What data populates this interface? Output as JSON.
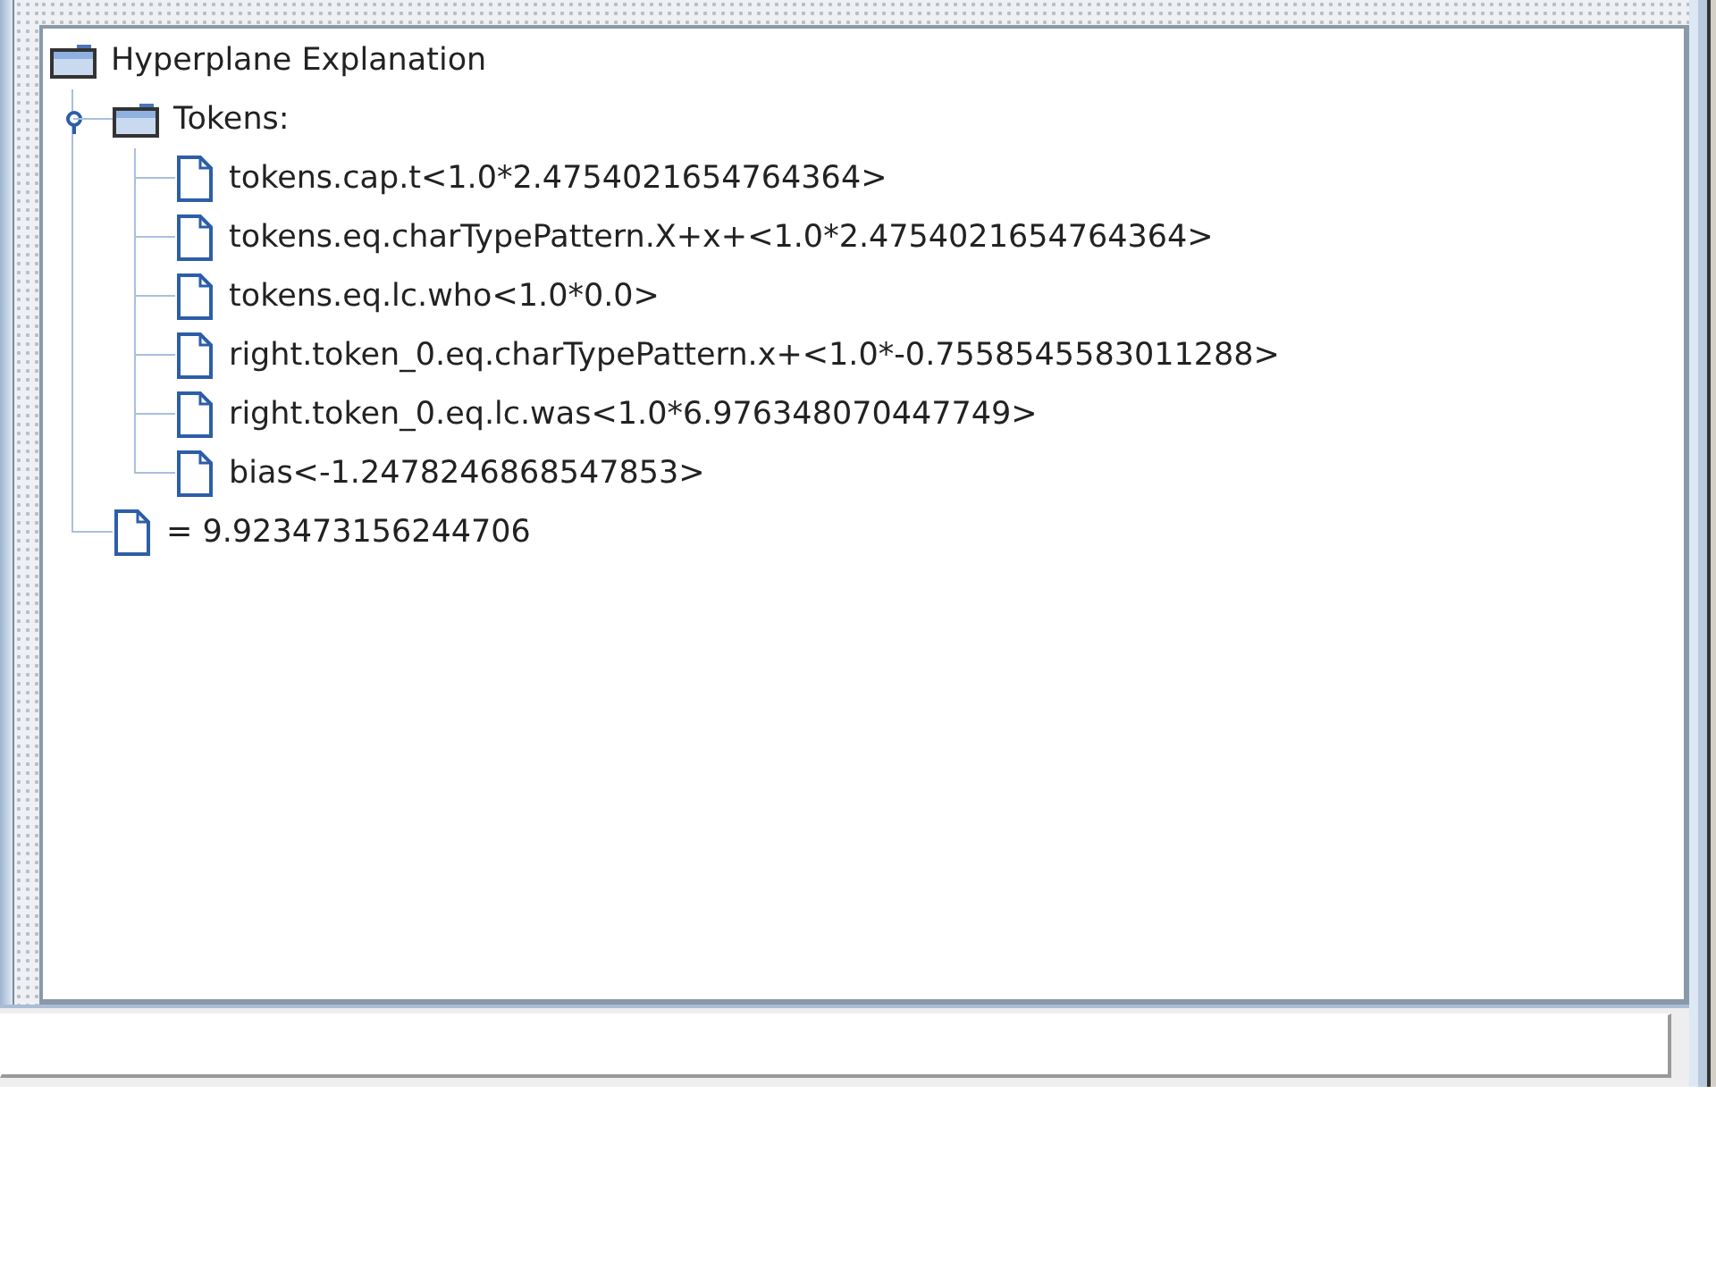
{
  "tree": {
    "label": "Hyperplane Explanation",
    "kind": "folder",
    "children": [
      {
        "label": "Tokens:",
        "kind": "folder",
        "expanded": true,
        "children": [
          {
            "label": "tokens.cap.t<1.0*2.4754021654764364>",
            "kind": "leaf"
          },
          {
            "label": "tokens.eq.charTypePattern.X+x+<1.0*2.4754021654764364>",
            "kind": "leaf"
          },
          {
            "label": "tokens.eq.lc.who<1.0*0.0>",
            "kind": "leaf"
          },
          {
            "label": "right.token_0.eq.charTypePattern.x+<1.0*-0.7558545583011288>",
            "kind": "leaf"
          },
          {
            "label": "right.token_0.eq.lc.was<1.0*6.976348070447749>",
            "kind": "leaf"
          },
          {
            "label": "bias<-1.2478246868547853>",
            "kind": "leaf"
          }
        ]
      },
      {
        "label": "= 9.923473156244706",
        "kind": "leaf"
      }
    ]
  }
}
